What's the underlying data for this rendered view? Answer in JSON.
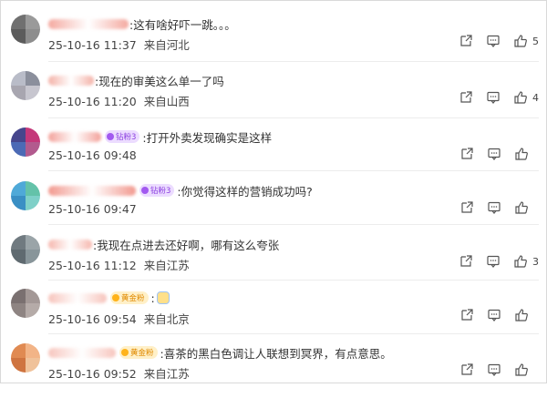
{
  "comments": [
    {
      "text": ":这有啥好吓一跳。。。",
      "date": "25-10-16 11:37",
      "location": "来自河北",
      "likes": "5",
      "avatar_colors": [
        "#707070",
        "#9a9a9a",
        "#5c5c5c",
        "#8d8d8d"
      ],
      "name_color": "#f4a9a0",
      "name_width": 88
    },
    {
      "text": ":现在的审美这么单一了吗",
      "date": "25-10-16 11:20",
      "location": "来自山西",
      "likes": "4",
      "avatar_colors": [
        "#b9bcc8",
        "#8b8f9c",
        "#a8a6b0",
        "#c7c6cf"
      ],
      "name_color": "#f4b2a8",
      "name_width": 50
    },
    {
      "badge": "钻粉3",
      "text": ":打开外卖发现确实是这样",
      "date": "25-10-16 09:48",
      "location": "",
      "likes": "",
      "avatar_colors": [
        "#46468c",
        "#c4387a",
        "#4c6ab5",
        "#b25a8e"
      ],
      "name_color": "#f3a29b",
      "name_width": 58
    },
    {
      "badge": "钻粉3",
      "text": ":你觉得这样的营销成功吗?",
      "date": "25-10-16 09:47",
      "location": "",
      "likes": "",
      "avatar_colors": [
        "#4fa9d8",
        "#64c2a9",
        "#3a8fc4",
        "#7fd0c8"
      ],
      "name_color": "#f2998f",
      "name_width": 96
    },
    {
      "text": ":我现在点进去还好啊，哪有这么夸张",
      "date": "25-10-16 11:12",
      "location": "来自江苏",
      "likes": "3",
      "avatar_colors": [
        "#707a80",
        "#9aa4a8",
        "#5f6a70",
        "#88959a"
      ],
      "name_color": "#f6b7ae",
      "name_width": 48
    },
    {
      "badge": "黄金粉",
      "text": ":",
      "emoji": "emoji-face",
      "date": "25-10-16 09:54",
      "location": "来自北京",
      "likes": "",
      "avatar_colors": [
        "#7a7070",
        "#a39896",
        "#8e8482",
        "#b5aba8"
      ],
      "name_color": "#f7c4bc",
      "name_width": 64
    },
    {
      "badge": "黄金粉",
      "text": ":喜茶的黑白色调让人联想到冥界，有点意思。",
      "date": "25-10-16 09:52",
      "location": "来自江苏",
      "likes": "",
      "avatar_colors": [
        "#e08a52",
        "#f2b487",
        "#cf7440",
        "#f0c29a"
      ],
      "name_color": "#f7c6be",
      "name_width": 74
    }
  ],
  "icons": {
    "share": "share-icon",
    "reply": "comment-icon",
    "like": "thumbs-up-icon"
  }
}
